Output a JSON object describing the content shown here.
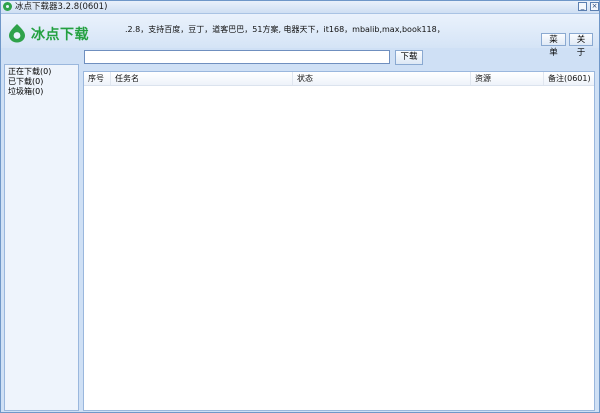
{
  "window": {
    "title": "冰点下载器3.2.8(0601)",
    "min_label": "_",
    "close_label": "×"
  },
  "header": {
    "logo_text": "冰点下载",
    "notice": ".2.8，支持百度，豆丁，道客巴巴，51方案, 电器天下，it168，mbalib,max,book118，",
    "menu_label": "菜单",
    "about_label": "关于"
  },
  "search": {
    "value": "",
    "placeholder": "",
    "download_label": "下载"
  },
  "sidebar": {
    "items": [
      {
        "label": "正在下载(0)"
      },
      {
        "label": "已下载(0)"
      },
      {
        "label": "垃圾箱(0)"
      }
    ]
  },
  "table": {
    "columns": [
      "序号",
      "任务名",
      "状态",
      "资源",
      "备注(0601)"
    ],
    "rows": []
  },
  "colors": {
    "brand_green": "#23a040",
    "frame_blue": "#cfe0f5",
    "border_blue": "#6f97c8"
  }
}
